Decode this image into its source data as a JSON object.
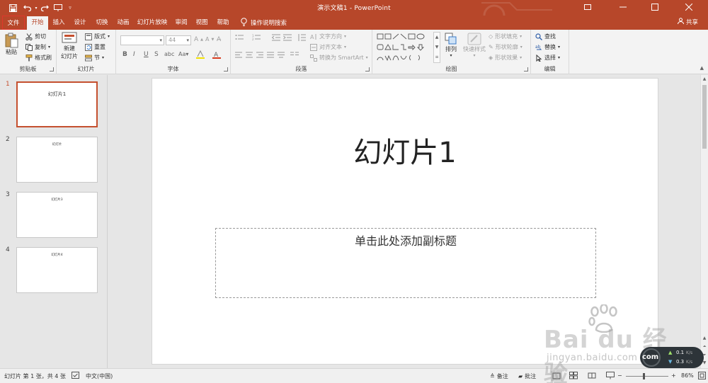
{
  "titlebar": {
    "document_title": "演示文稿1 - PowerPoint"
  },
  "tabs": [
    "文件",
    "开始",
    "插入",
    "设计",
    "切换",
    "动画",
    "幻灯片放映",
    "审阅",
    "视图",
    "帮助"
  ],
  "tell_me": "操作说明搜索",
  "share": "共享",
  "ribbon": {
    "clipboard": {
      "paste": "粘贴",
      "cut": "剪切",
      "copy": "复制",
      "format_painter": "格式刷",
      "label": "剪贴板"
    },
    "slides": {
      "new_slide_line1": "新建",
      "new_slide_line2": "幻灯片",
      "layout": "版式",
      "reset": "重置",
      "section": "节",
      "label": "幻灯片"
    },
    "font": {
      "size": "44",
      "bold": "B",
      "italic": "I",
      "underline": "U",
      "strikethrough": "S",
      "label": "字体"
    },
    "paragraph": {
      "text_direction": "文字方向",
      "align_text": "对齐文本",
      "smartart": "转换为 SmartArt",
      "label": "段落"
    },
    "drawing": {
      "arrange": "排列",
      "quick_styles": "快速样式",
      "shape_fill": "形状填充",
      "shape_outline": "形状轮廓",
      "shape_effects": "形状效果",
      "label": "绘图"
    },
    "editing": {
      "find": "查找",
      "replace": "替换",
      "select": "选择",
      "label": "编辑"
    }
  },
  "thumbnails": [
    {
      "number": "1",
      "title": "幻灯片1"
    },
    {
      "number": "2",
      "title": "幻灯片"
    },
    {
      "number": "3",
      "title": "幻灯片3"
    },
    {
      "number": "4",
      "title": "幻灯片4"
    }
  ],
  "slide": {
    "title": "幻灯片1",
    "subtitle_placeholder": "单击此处添加副标题"
  },
  "statusbar": {
    "slide_info": "幻灯片 第 1 张，共 4 张",
    "language": "中文(中国)",
    "notes": "备注",
    "comments": "批注",
    "zoom": "86%"
  },
  "overlay": {
    "watermark_brand": "Bai du 经验",
    "watermark_url": "jingyan.baidu.com",
    "net_up": "0.1",
    "net_down": "0.3",
    "net_unit": "K/s",
    "badge_text": "com"
  },
  "colors": {
    "accent": "#b7472a",
    "selection": "#c5502f"
  }
}
